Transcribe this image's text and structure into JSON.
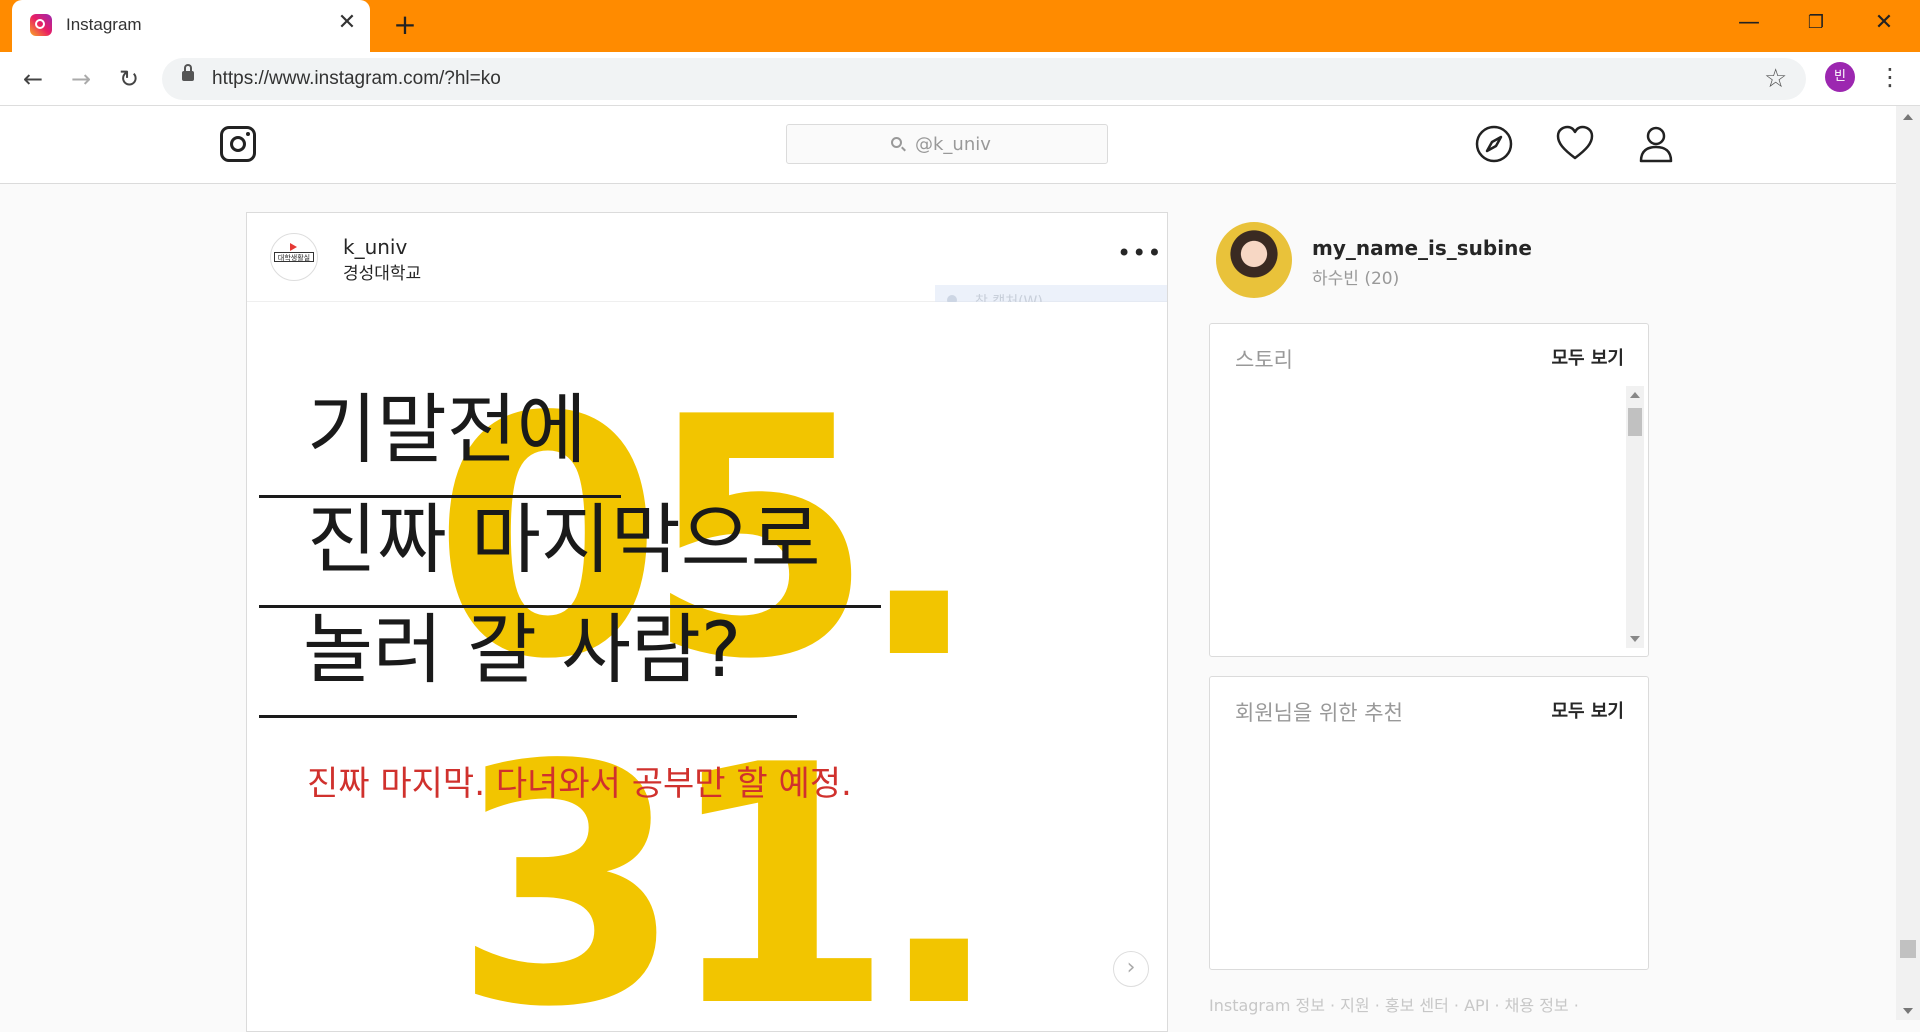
{
  "browser": {
    "tab_title": "Instagram",
    "tab_close": "✕",
    "new_tab": "+",
    "url": "https://www.instagram.com/?hl=ko",
    "profile_initial": "빈",
    "window_controls": {
      "minimize": "—",
      "restore": "❐",
      "close": "✕"
    }
  },
  "header": {
    "search_value": "@k_univ",
    "icons": [
      "explore-compass-icon",
      "heart-icon",
      "profile-icon"
    ]
  },
  "post": {
    "username": "k_univ",
    "location": "경성대학교",
    "more": "•••",
    "avatar_label": "대학생활실게",
    "ghost_menu": "창 캡처(W)",
    "image": {
      "big_number_top": "05.",
      "big_number_bottom": "31.",
      "line1": "기말전에",
      "line2": "진짜 마지막으로",
      "line3": "놀러 갈 사람?",
      "subline": "진짜 마지막. 다녀와서 공부만 할 예정.",
      "accent_yellow": "#f2c500",
      "accent_red": "#d0312d"
    },
    "next_icon": "›"
  },
  "sidebar": {
    "username": "my_name_is_subine",
    "full_name": "하수빈 (20)",
    "stories": {
      "title": "스토리",
      "link": "모두 보기"
    },
    "suggestions": {
      "title": "회원님을 위한 추천",
      "link": "모두 보기"
    },
    "footer": "Instagram 정보 · 지원 · 홍보 센터 · API · 채용 정보 ·"
  },
  "colors": {
    "chrome_frame": "#ff8b00",
    "page_bg": "#fafafa"
  }
}
